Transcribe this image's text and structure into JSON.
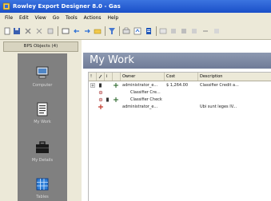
{
  "window": {
    "title": "Rowley Export Designer 8.0 - Gas",
    "accent": "#245edb"
  },
  "menu": {
    "items": [
      "File",
      "Edit",
      "View",
      "Go",
      "Tools",
      "Actions",
      "Help"
    ]
  },
  "toolbar": {
    "icons": [
      "new-icon",
      "save-icon",
      "delete-icon",
      "close-icon",
      "navigate-icon",
      "forward-icon",
      "back-icon",
      "folder-icon",
      "filter-icon",
      "print-icon",
      "tools-icon",
      "report-icon",
      "list-icon",
      "options-icon"
    ]
  },
  "left_pane": {
    "tab_label": "BPS Objects (4)",
    "shortcuts": [
      {
        "icon": "computer-icon",
        "label": "Computer"
      },
      {
        "icon": "document-icon",
        "label": "My Work"
      },
      {
        "icon": "briefcase-icon",
        "label": "My Details"
      },
      {
        "icon": "grid-icon",
        "label": "Tables"
      }
    ]
  },
  "main": {
    "header": "My Work",
    "columns": [
      "Owner",
      "Cost",
      "Description"
    ],
    "rows": [
      {
        "owner": "administrator_e...",
        "cost": "$ 1,264.00",
        "description": "Classifier Credit a..."
      },
      {
        "owner": "Classifier Cre...",
        "cost": "",
        "description": ""
      },
      {
        "owner": "Classifier Check",
        "cost": "",
        "description": ""
      },
      {
        "owner": "administrator_e...",
        "cost": "",
        "description": "Ubi sunt leges IV..."
      }
    ]
  }
}
